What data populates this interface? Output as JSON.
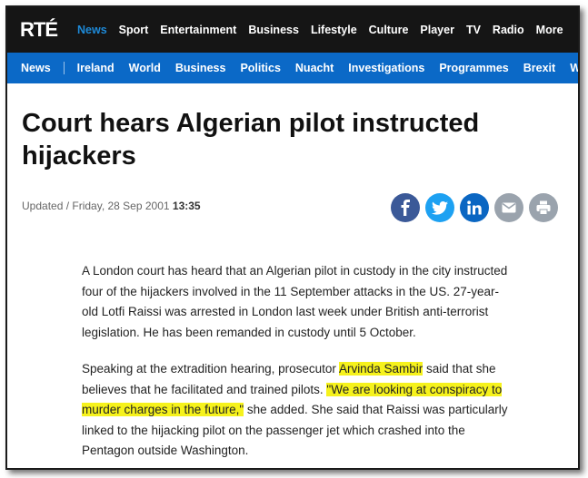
{
  "site": {
    "logo": "RTÉ"
  },
  "topnav": {
    "items": [
      "News",
      "Sport",
      "Entertainment",
      "Business",
      "Lifestyle",
      "Culture",
      "Player",
      "TV",
      "Radio",
      "More"
    ]
  },
  "subnav": {
    "first": "News",
    "items": [
      "Ireland",
      "World",
      "Business",
      "Politics",
      "Nuacht",
      "Investigations",
      "Programmes",
      "Brexit",
      "Watch Live"
    ]
  },
  "article": {
    "headline": "Court hears Algerian pilot instructed hijackers",
    "meta_prefix": "Updated / Friday, 28 Sep 2001",
    "meta_time": "13:35",
    "p1": "A London court has heard that an Algerian pilot in custody in the city instructed four of the hijackers involved in the 11 September attacks in the US. 27-year-old Lotfi Raissi was arrested in London last week under British anti-terrorist legislation. He has been remanded in custody until 5 October.",
    "p2_a": "Speaking at the extradition hearing, prosecutor ",
    "p2_name": "Arvinda Sambir",
    "p2_b": " said that she believes that he facilitated and trained pilots. ",
    "p2_quote": "\"We are looking at conspiracy to murder charges in the future,\"",
    "p2_c": " she added. She said that Raissi was particularly linked to the hijacking pilot on the passenger jet which crashed into the Pentagon outside Washington."
  },
  "share": {
    "colors": {
      "facebook": "#3b5998",
      "twitter": "#1da1f2",
      "linkedin": "#0a66c2",
      "email": "#9aa3ad",
      "print": "#9aa3ad"
    },
    "icons": [
      "facebook-icon",
      "twitter-icon",
      "linkedin-icon",
      "email-icon",
      "print-icon"
    ]
  }
}
